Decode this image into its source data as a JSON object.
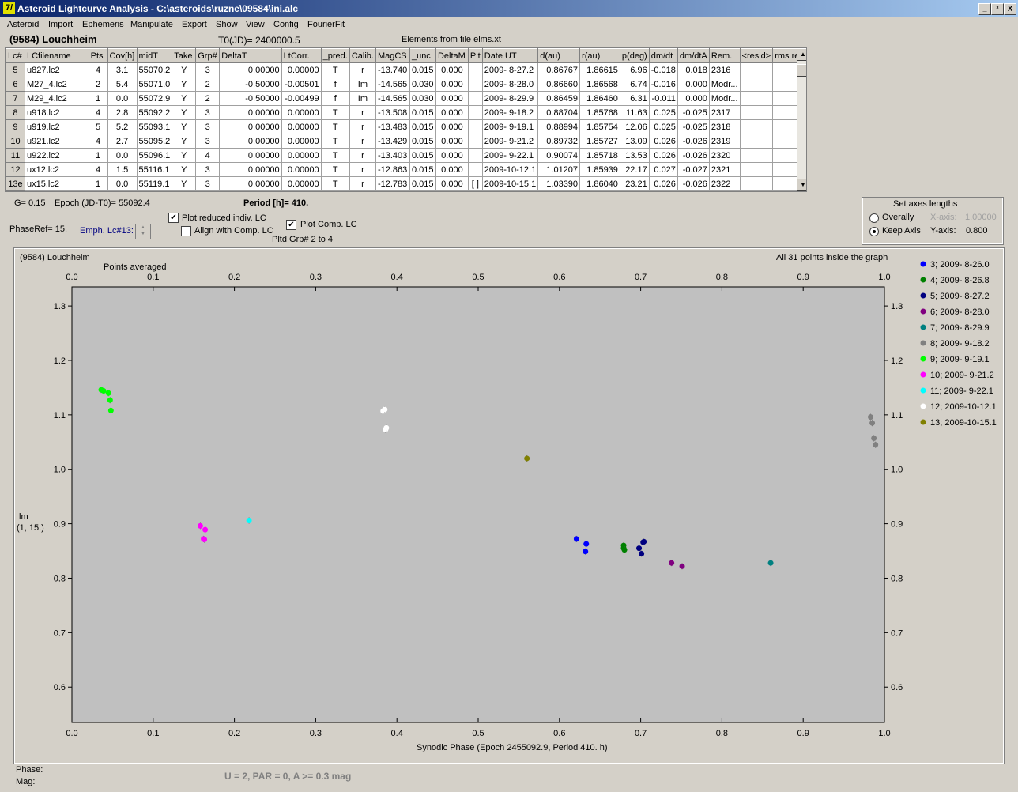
{
  "window": {
    "title": "Asteroid Lightcurve Analysis - C:\\asteroids\\ruzne\\09584\\ini.alc",
    "icon_glyph": "7/",
    "controls": [
      "_",
      "²",
      "X"
    ]
  },
  "menu": [
    "Asteroid",
    "Import",
    "Ephemeris",
    "Manipulate",
    "Export",
    "Show",
    "View",
    "Config",
    "FourierFit"
  ],
  "header": {
    "asteroid_name": "(9584) Louchheim",
    "t0": "T0(JD)= 2400000.5",
    "elements": "Elements from file elms.xt"
  },
  "table": {
    "columns": [
      "Lc#",
      "LCfilename",
      "Pts",
      "Cov[h]",
      "midT",
      "Take",
      "Grp#",
      "DeltaT",
      "LtCorr.",
      "_pred.",
      "Calib.",
      "MagCS",
      "_unc",
      "DeltaM",
      "Plt",
      "Date UT",
      "d(au)",
      "r(au)",
      "p(deg)",
      "dm/dt",
      "dm/dtA",
      "Rem.",
      "<resid>",
      "rms res"
    ],
    "rows": [
      [
        "5",
        "u827.lc2",
        "4",
        "3.1",
        "55070.2",
        "Y",
        "3",
        "0.00000",
        "0.00000",
        "T",
        "r",
        "-13.740",
        "0.015",
        "0.000",
        "",
        "2009- 8-27.2",
        "0.86767",
        "1.86615",
        "6.96",
        "-0.018",
        "0.018",
        "2316",
        "",
        ""
      ],
      [
        "6",
        "M27_4.lc2",
        "2",
        "5.4",
        "55071.0",
        "Y",
        "2",
        "-0.50000",
        "-0.00501",
        "f",
        "Im",
        "-14.565",
        "0.030",
        "0.000",
        "",
        "2009- 8-28.0",
        "0.86660",
        "1.86568",
        "6.74",
        "-0.016",
        "0.000",
        "Modr...",
        "",
        ""
      ],
      [
        "7",
        "M29_4.lc2",
        "1",
        "0.0",
        "55072.9",
        "Y",
        "2",
        "-0.50000",
        "-0.00499",
        "f",
        "Im",
        "-14.565",
        "0.030",
        "0.000",
        "",
        "2009- 8-29.9",
        "0.86459",
        "1.86460",
        "6.31",
        "-0.011",
        "0.000",
        "Modr...",
        "",
        ""
      ],
      [
        "8",
        "u918.lc2",
        "4",
        "2.8",
        "55092.2",
        "Y",
        "3",
        "0.00000",
        "0.00000",
        "T",
        "r",
        "-13.508",
        "0.015",
        "0.000",
        "",
        "2009- 9-18.2",
        "0.88704",
        "1.85768",
        "11.63",
        "0.025",
        "-0.025",
        "2317",
        "",
        ""
      ],
      [
        "9",
        "u919.lc2",
        "5",
        "5.2",
        "55093.1",
        "Y",
        "3",
        "0.00000",
        "0.00000",
        "T",
        "r",
        "-13.483",
        "0.015",
        "0.000",
        "",
        "2009- 9-19.1",
        "0.88994",
        "1.85754",
        "12.06",
        "0.025",
        "-0.025",
        "2318",
        "",
        ""
      ],
      [
        "10",
        "u921.lc2",
        "4",
        "2.7",
        "55095.2",
        "Y",
        "3",
        "0.00000",
        "0.00000",
        "T",
        "r",
        "-13.429",
        "0.015",
        "0.000",
        "",
        "2009- 9-21.2",
        "0.89732",
        "1.85727",
        "13.09",
        "0.026",
        "-0.026",
        "2319",
        "",
        ""
      ],
      [
        "11",
        "u922.lc2",
        "1",
        "0.0",
        "55096.1",
        "Y",
        "4",
        "0.00000",
        "0.00000",
        "T",
        "r",
        "-13.403",
        "0.015",
        "0.000",
        "",
        "2009- 9-22.1",
        "0.90074",
        "1.85718",
        "13.53",
        "0.026",
        "-0.026",
        "2320",
        "",
        ""
      ],
      [
        "12",
        "ux12.lc2",
        "4",
        "1.5",
        "55116.1",
        "Y",
        "3",
        "0.00000",
        "0.00000",
        "T",
        "r",
        "-12.863",
        "0.015",
        "0.000",
        "",
        "2009-10-12.1",
        "1.01207",
        "1.85939",
        "22.17",
        "0.027",
        "-0.027",
        "2321",
        "",
        ""
      ],
      [
        "13e",
        "ux15.lc2",
        "1",
        "0.0",
        "55119.1",
        "Y",
        "3",
        "0.00000",
        "0.00000",
        "T",
        "r",
        "-12.783",
        "0.015",
        "0.000",
        "[ ]",
        "2009-10-15.1",
        "1.03390",
        "1.86040",
        "23.21",
        "0.026",
        "-0.026",
        "2322",
        "",
        ""
      ]
    ]
  },
  "controls": {
    "g_value": "G= 0.15",
    "epoch": "Epoch (JD-T0)= 55092.4",
    "period": "Period [h]= 410.",
    "phase_ref": "PhaseRef= 15.",
    "emph_lc": "Emph. Lc#13:",
    "plot_reduced_label": "Plot reduced indiv. LC",
    "plot_reduced_checked": true,
    "align_label": "Align with Comp. LC",
    "align_checked": false,
    "plot_comp_label": "Plot Comp. LC",
    "plot_comp_checked": true,
    "pltd_grp": "Pltd Grp#  2   to   4"
  },
  "axes_box": {
    "title": "Set axes lengths",
    "overally_label": "Overally",
    "keep_axis_label": "Keep Axis",
    "x_axis_label": "X-axis:",
    "x_axis_value": "1.00000",
    "y_axis_label": "Y-axis:",
    "y_axis_value": "0.800",
    "selected": "keep_axis"
  },
  "graph": {
    "name": "(9584) Louchheim",
    "points_averaged": "Points averaged",
    "inside_note": "All 31 points inside the graph",
    "y_label_1": "lm",
    "y_label_2": "(1, 15.)",
    "x_label": "Synodic Phase (Epoch 2455092.9, Period 410. h)"
  },
  "chart_data": {
    "type": "scatter",
    "xlabel": "Synodic Phase (Epoch 2455092.9, Period 410. h)",
    "ylabel": "lm (1, 15.)",
    "xlim": [
      0.0,
      1.0
    ],
    "ylim": [
      1.335,
      0.535
    ],
    "y_inverted": true,
    "x_ticks": [
      "0.0",
      "0.1",
      "0.2",
      "0.3",
      "0.4",
      "0.5",
      "0.6",
      "0.7",
      "0.8",
      "0.9",
      "1.0"
    ],
    "y_ticks": [
      "0.6",
      "0.7",
      "0.8",
      "0.9",
      "1.0",
      "1.1",
      "1.2",
      "1.3"
    ],
    "grid": false,
    "legend_position": "right",
    "series": [
      {
        "name": "3; 2009- 8-26.0",
        "color": "#0000ff",
        "points": [
          [
            0.621,
            0.872
          ],
          [
            0.632,
            0.849
          ],
          [
            0.633,
            0.863
          ]
        ]
      },
      {
        "name": "4; 2009- 8-26.8",
        "color": "#008000",
        "points": [
          [
            0.679,
            0.855
          ],
          [
            0.679,
            0.86
          ],
          [
            0.68,
            0.852
          ]
        ]
      },
      {
        "name": "5; 2009- 8-27.2",
        "color": "#000080",
        "points": [
          [
            0.698,
            0.855
          ],
          [
            0.701,
            0.845
          ],
          [
            0.703,
            0.866
          ],
          [
            0.704,
            0.867
          ]
        ]
      },
      {
        "name": "6; 2009- 8-28.0",
        "color": "#800080",
        "points": [
          [
            0.738,
            0.828
          ],
          [
            0.751,
            0.822
          ]
        ]
      },
      {
        "name": "7; 2009- 8-29.9",
        "color": "#008080",
        "points": [
          [
            0.86,
            0.828
          ]
        ]
      },
      {
        "name": "8; 2009- 9-18.2",
        "color": "#808080",
        "points": [
          [
            0.983,
            1.096
          ],
          [
            0.985,
            1.085
          ],
          [
            0.987,
            1.057
          ],
          [
            0.989,
            1.045
          ]
        ]
      },
      {
        "name": "9; 2009- 9-19.1",
        "color": "#00ff00",
        "points": [
          [
            0.036,
            1.146
          ],
          [
            0.039,
            1.144
          ],
          [
            0.045,
            1.14
          ],
          [
            0.047,
            1.127
          ],
          [
            0.048,
            1.108
          ]
        ]
      },
      {
        "name": "10; 2009- 9-21.2",
        "color": "#ff00ff",
        "points": [
          [
            0.158,
            0.896
          ],
          [
            0.162,
            0.872
          ],
          [
            0.163,
            0.871
          ],
          [
            0.164,
            0.889
          ]
        ]
      },
      {
        "name": "11; 2009- 9-22.1",
        "color": "#00ffff",
        "points": [
          [
            0.218,
            0.906
          ]
        ]
      },
      {
        "name": "12; 2009-10-12.1",
        "color": "#ffffff",
        "points": [
          [
            0.383,
            1.107
          ],
          [
            0.385,
            1.11
          ],
          [
            0.386,
            1.073
          ],
          [
            0.387,
            1.076
          ]
        ]
      },
      {
        "name": "13; 2009-10-15.1",
        "color": "#808000",
        "points": [
          [
            0.56,
            1.02
          ]
        ]
      }
    ]
  },
  "footer": {
    "phase_label": "Phase:",
    "mag_label": "Mag:",
    "status": "U = 2, PAR = 0, A >= 0.3 mag"
  }
}
